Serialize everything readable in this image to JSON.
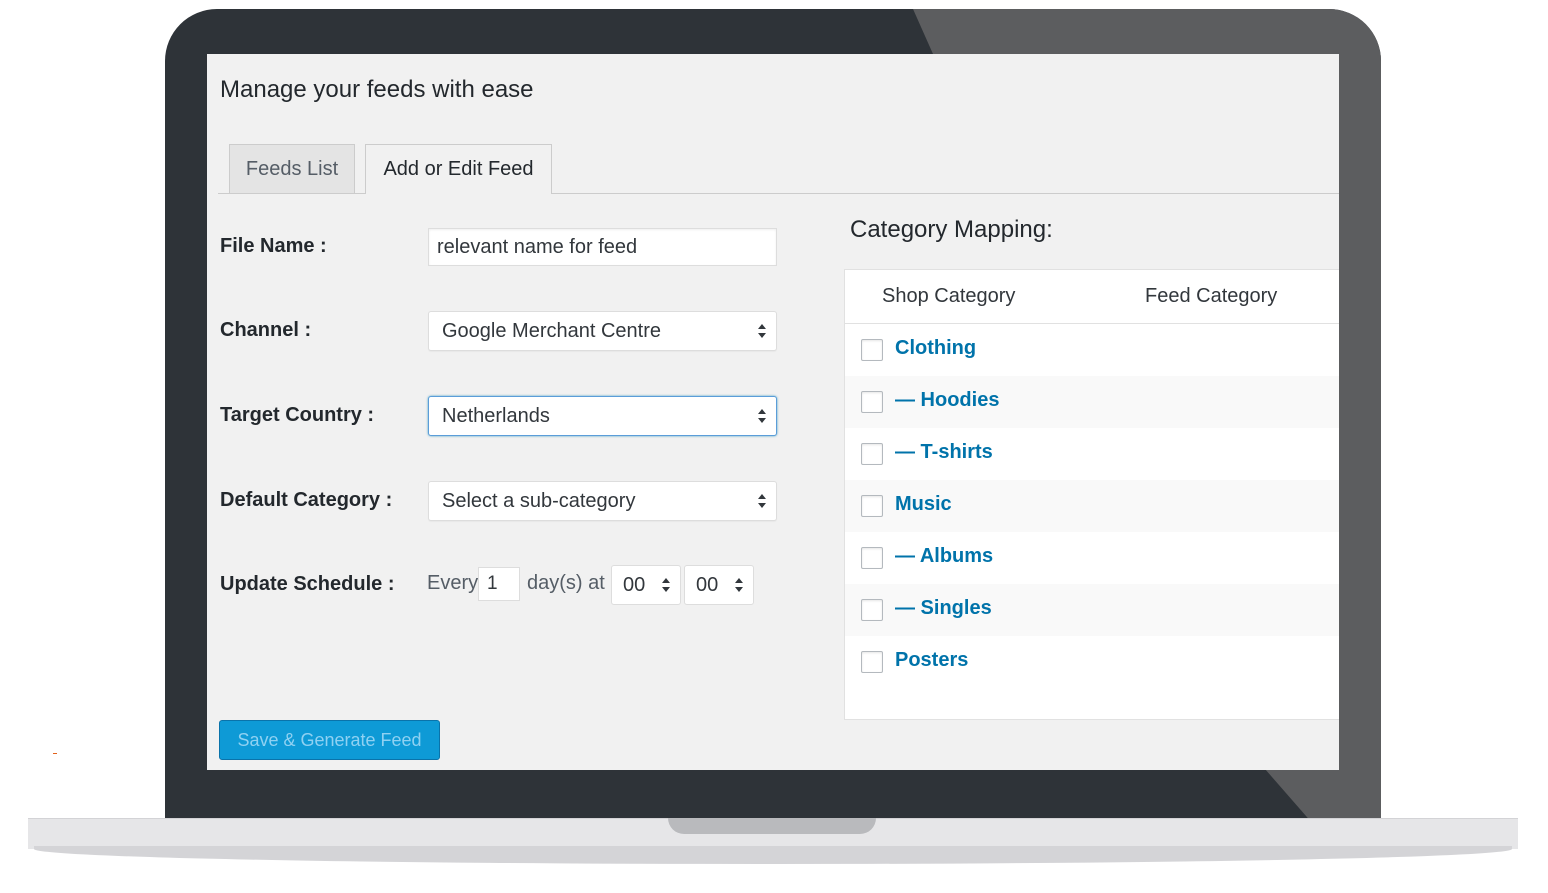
{
  "page": {
    "title": "Manage your feeds with ease"
  },
  "tabs": [
    {
      "label": "Feeds List",
      "active": false
    },
    {
      "label": "Add or Edit Feed",
      "active": true
    }
  ],
  "form": {
    "file_name": {
      "label": "File Name :",
      "value": "relevant name for feed"
    },
    "channel": {
      "label": "Channel :",
      "selected": "Google Merchant Centre"
    },
    "target_country": {
      "label": "Target Country :",
      "selected": "Netherlands"
    },
    "default_category": {
      "label": "Default Category :",
      "selected": "Select a sub-category"
    },
    "update_schedule": {
      "label": "Update Schedule :",
      "every_text": "Every",
      "days_value": "1",
      "days_text": "day(s) at",
      "hour": "00",
      "minute": "00"
    },
    "save_button": "Save & Generate Feed"
  },
  "category_mapping": {
    "title": "Category Mapping:",
    "columns": [
      "Shop Category",
      "Feed Category"
    ],
    "rows": [
      {
        "label": "Clothing"
      },
      {
        "label": "— Hoodies"
      },
      {
        "label": "— T-shirts"
      },
      {
        "label": "Music"
      },
      {
        "label": "— Albums"
      },
      {
        "label": "— Singles"
      },
      {
        "label": "Posters"
      }
    ]
  },
  "colors": {
    "link": "#0073aa",
    "primary_button": "#0e9ad6",
    "laptop_frame": "#2e3338"
  }
}
